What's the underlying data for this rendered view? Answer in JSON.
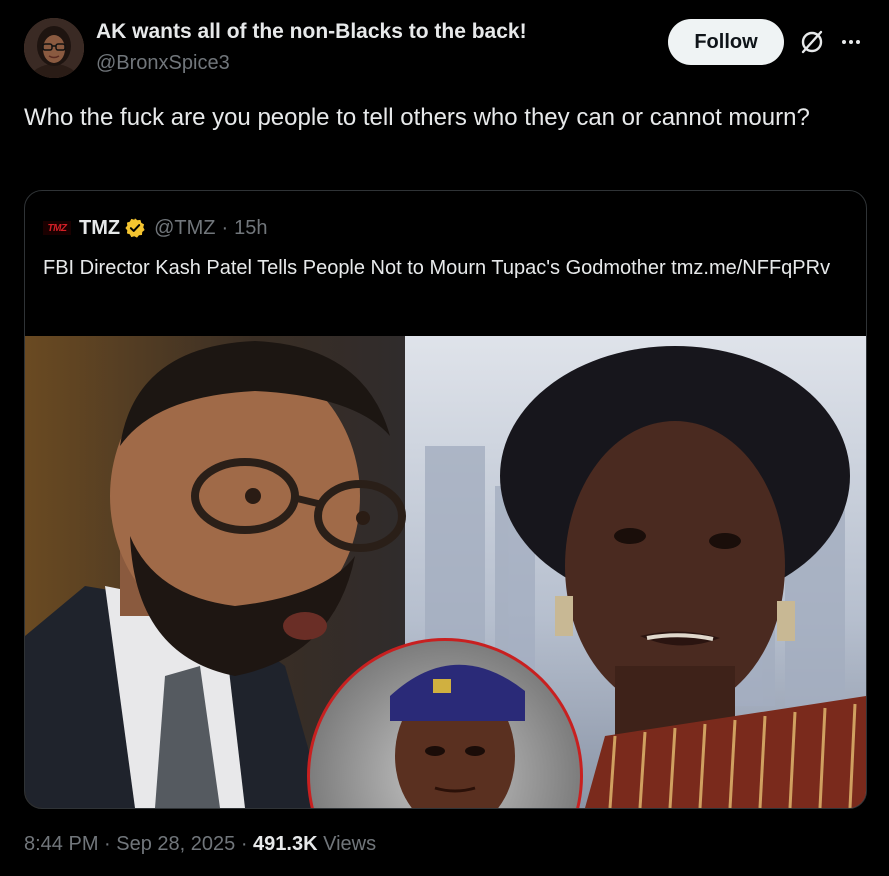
{
  "author": {
    "display_name": "AK wants all of the non-Blacks to the back!",
    "handle": "@BronxSpice3"
  },
  "follow_label": "Follow",
  "icons": {
    "grok": "grok-icon",
    "more": "more-icon",
    "verified": "verified-gold-icon"
  },
  "tweet_text": "Who the fuck are you people to tell others who they can or cannot mourn?",
  "quote": {
    "logo_text": "TMZ",
    "name": "TMZ",
    "handle": "@TMZ",
    "separator": "·",
    "age": "15h",
    "text": "FBI Director Kash Patel Tells People Not to Mourn Tupac's Godmother tmz.me/NFFqPRv"
  },
  "footer": {
    "time": "8:44 PM",
    "date": "Sep 28, 2025",
    "views_count": "491.3K",
    "views_label": "Views"
  },
  "colors": {
    "background": "#000000",
    "text": "#e7e9ea",
    "muted": "#71767b",
    "border": "#2f3336",
    "follow_bg": "#eff3f4",
    "verified": "#f4c430",
    "tmz_red": "#d41f26"
  }
}
